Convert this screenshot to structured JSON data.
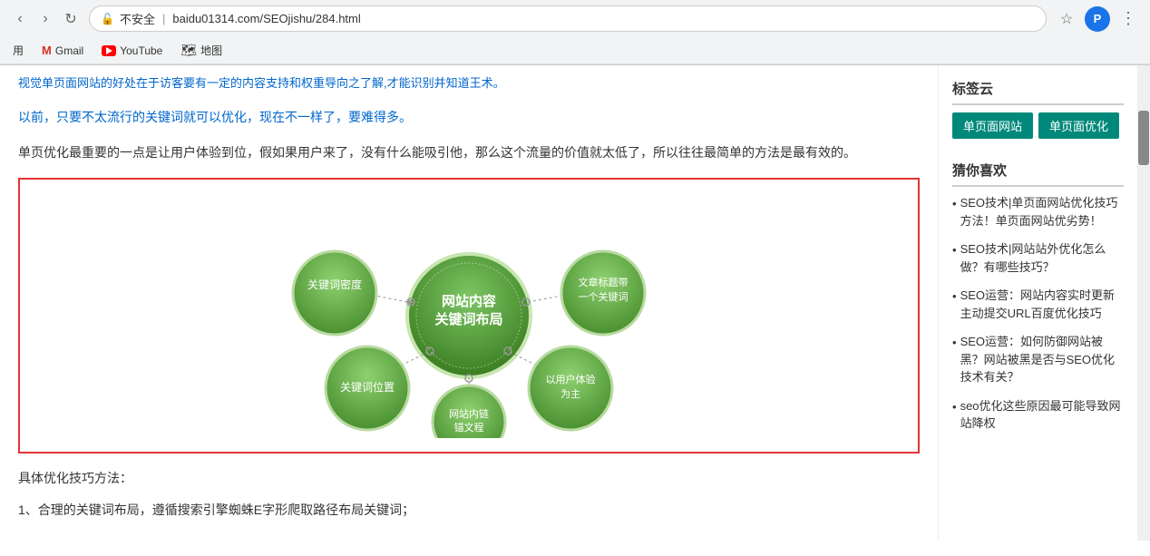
{
  "browser": {
    "nav_back": "‹",
    "nav_forward": "›",
    "nav_refresh": "↻",
    "lock_label": "不安全",
    "address": "baidu01314.com/SEOjishu/284.html",
    "star_label": "☆",
    "extension_label": "P"
  },
  "bookmarks": {
    "apps_label": "用",
    "gmail_label": "Gmail",
    "youtube_label": "YouTube",
    "maps_label": "地图"
  },
  "main": {
    "top_text": "视觉单页面网站的好处在于访客要有一定的内容支持和权重导向之了解,才能识别并知道王术。",
    "paragraph1": "以前，只要不太流行的关键词就可以优化，现在不一样了，要难得多。",
    "paragraph2": "单页优化最重要的一点是让用户体验到位，假如果用户来了，没有什么能吸引他，那么这个流量的价值就太低了，所以往往最简单的方法是最有效的。",
    "diagram_alt": "网站内容关键词布局图",
    "center_node": "网站内容\n关键词布局",
    "node_kw_density": "关键词密度",
    "node_article_title": "文章标题带\n一个关键词",
    "node_kw_position": "关键词位置",
    "node_user_exp": "以用户体验\n为主",
    "node_internal_link": "网站内链\n锚文程",
    "bottom_text1": "具体优化技巧方法：",
    "bottom_text2": "1、合理的关键词布局，遵循搜索引擎蜘蛛E字形爬取路径布局关键词；"
  },
  "sidebar": {
    "tag_cloud_title": "标签云",
    "tag1": "单页面网站",
    "tag2": "单页面优化",
    "related_title": "猜你喜欢",
    "related_items": [
      "SEO技术|单页面网站优化技巧方法！单页面网站优劣势！",
      "SEO技术|网站站外优化怎么做？有哪些技巧？",
      "SEO运营：网站内容实时更新主动提交URL百度优化技巧",
      "SEO运营：如何防御网站被黑？网站被黑是否与SEO优化技术有关？",
      "seo优化这些原因最可能导致网站降权"
    ]
  }
}
